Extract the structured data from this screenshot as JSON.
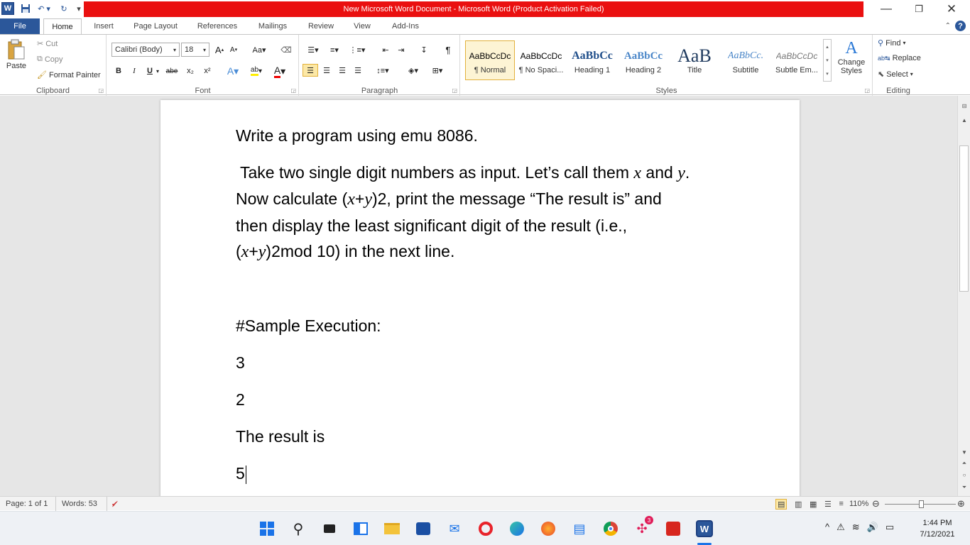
{
  "window": {
    "app_logo": "W",
    "title": "New Microsoft Word Document  -  Microsoft Word (Product Activation Failed)",
    "accent": "#2b579a",
    "title_bg": "#ea1010"
  },
  "tabs": [
    "File",
    "Home",
    "Insert",
    "Page Layout",
    "References",
    "Mailings",
    "Review",
    "View",
    "Add-Ins"
  ],
  "clipboard": {
    "paste": "Paste",
    "cut": "Cut",
    "copy": "Copy",
    "format_painter": "Format Painter",
    "label": "Clipboard"
  },
  "font": {
    "name": "Calibri (Body)",
    "size": "18",
    "label": "Font",
    "buttons": [
      "B",
      "I",
      "U",
      "abe",
      "x₂",
      "x²"
    ]
  },
  "paragraph": {
    "label": "Paragraph"
  },
  "styles": {
    "label": "Styles",
    "items": [
      {
        "preview": "AaBbCcDc",
        "name": "¶ Normal"
      },
      {
        "preview": "AaBbCcDc",
        "name": "¶ No Spaci..."
      },
      {
        "preview": "AaBbCc",
        "name": "Heading 1"
      },
      {
        "preview": "AaBbCc",
        "name": "Heading 2"
      },
      {
        "preview": "AaB",
        "name": "Title"
      },
      {
        "preview": "AaBbCc.",
        "name": "Subtitle"
      },
      {
        "preview": "AaBbCcDc",
        "name": "Subtle Em..."
      }
    ],
    "change_styles": "Change Styles"
  },
  "editing": {
    "find": "Find",
    "replace": "Replace",
    "select": "Select",
    "label": "Editing"
  },
  "document": {
    "line1": "Write a program using emu 8086.",
    "p2_a": " Take two single digit numbers as input. Let’s call them ",
    "var_x": "x",
    "p2_and": " and ",
    "var_y": "y",
    "p2_dot": ".",
    "p3_a": "Now calculate (",
    "p3_plus": "+",
    "p3_b": ")2, print the message “The result is” and",
    "p4": "then display the least significant digit of the result (i.e.,",
    "p5_a": "(",
    "p5_b": ")2mod 10) in the next line.",
    "sample_heading": "#Sample Execution:",
    "sample_lines": [
      "3",
      "2",
      "The result is",
      "5"
    ]
  },
  "status": {
    "page": "Page: 1 of 1",
    "words": "Words: 53",
    "zoom": "110%"
  },
  "taskbar": {
    "time": "1:44 PM",
    "date": "7/12/2021",
    "badge": "3"
  }
}
